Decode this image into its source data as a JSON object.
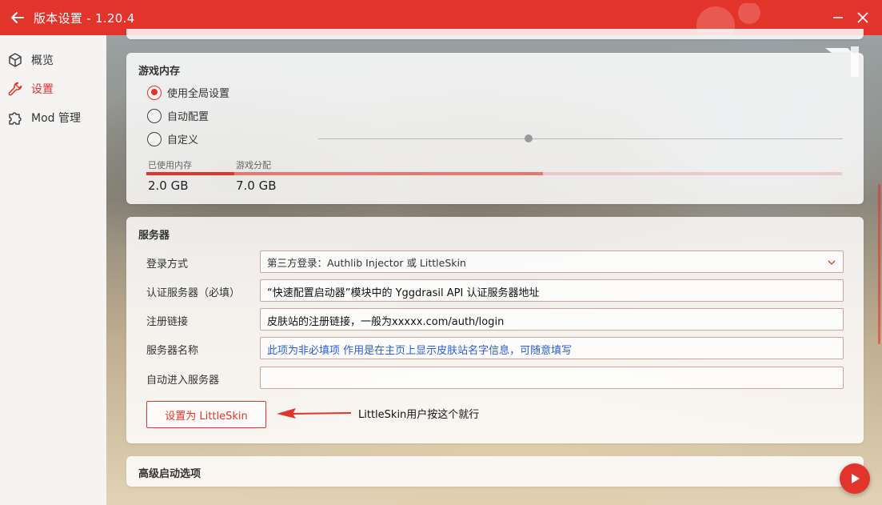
{
  "window": {
    "title": "版本设置 - 1.20.4"
  },
  "sidebar": {
    "items": [
      {
        "label": "概览",
        "icon": "cube-icon"
      },
      {
        "label": "设置",
        "icon": "wrench-icon"
      },
      {
        "label": "Mod 管理",
        "icon": "puzzle-icon"
      }
    ]
  },
  "memory": {
    "title": "游戏内存",
    "options": [
      "使用全局设置",
      "自动配置",
      "自定义"
    ],
    "selected": "使用全局设置",
    "used_label": "已使用内存",
    "used_value": "2.0 GB",
    "alloc_label": "游戏分配",
    "alloc_value": "7.0 GB"
  },
  "server": {
    "title": "服务器",
    "login_label": "登录方式",
    "login_value": "第三方登录：Authlib Injector 或 LittleSkin",
    "auth_label": "认证服务器（必填）",
    "auth_annotation": "“快速配置启动器”模块中的 Yggdrasil API 认证服务器地址",
    "register_label": "注册链接",
    "register_annotation": "皮肤站的注册链接，一般为xxxxx.com/auth/login",
    "name_label": "服务器名称",
    "name_annotation": "此项为非必填项 作用是在主页上显示皮肤站名字信息，可随意填写",
    "autojoin_label": "自动进入服务器",
    "littleskin_button": "设置为 LittleSkin",
    "littleskin_note": "LittleSkin用户按这个就行"
  },
  "advanced": {
    "title": "高级启动选项"
  },
  "colors": {
    "accent": "#e3342c",
    "annotation_blue": "#2a5bd7"
  }
}
